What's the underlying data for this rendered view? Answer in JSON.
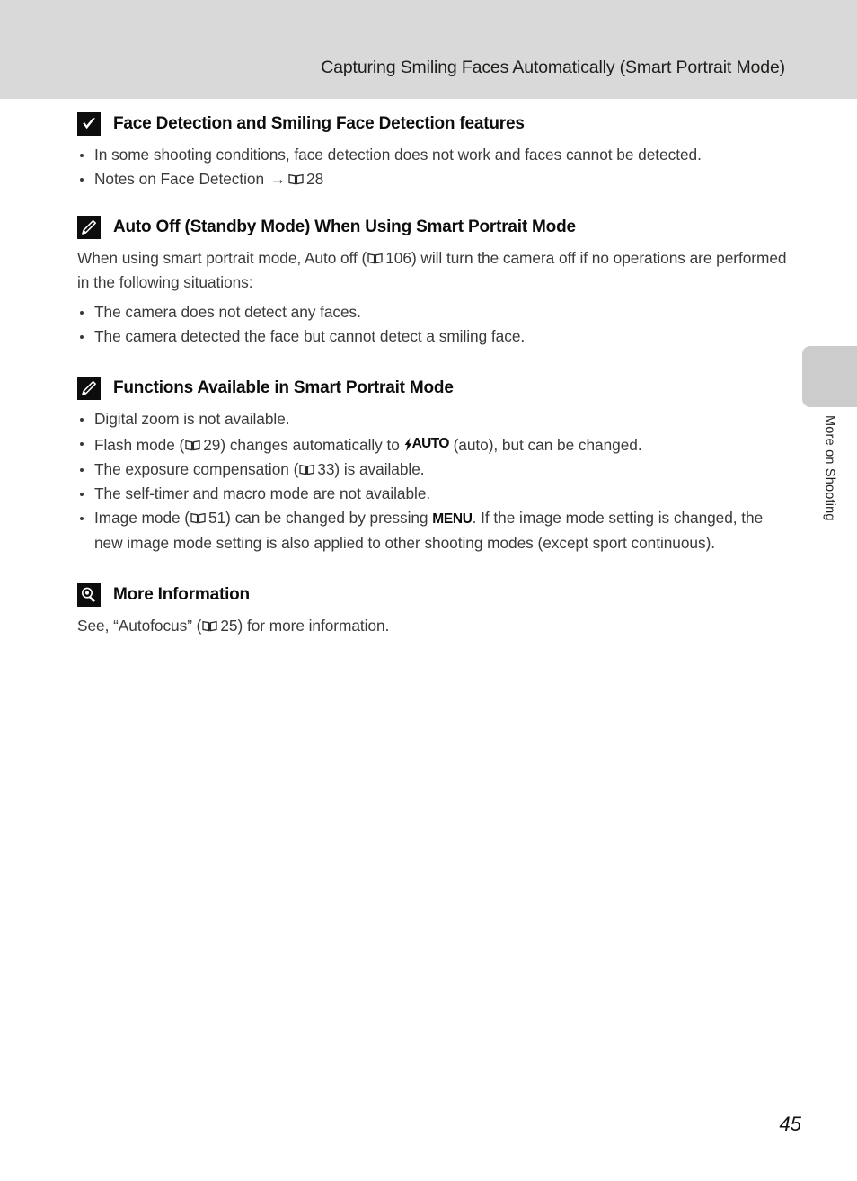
{
  "page": {
    "header_title": "Capturing Smiling Faces Automatically (Smart Portrait Mode)",
    "page_number": "45"
  },
  "side_tab": {
    "label": "More on Shooting"
  },
  "sections": [
    {
      "icon": "caution-check-icon",
      "title": "Face Detection and Smiling Face Detection features",
      "bullets": [
        {
          "parts": [
            {
              "text": "In some shooting conditions, face detection does not work and faces cannot be detected."
            }
          ]
        },
        {
          "parts": [
            {
              "text": "Notes on Face Detection "
            },
            {
              "glyph": "arrow-right",
              "text": "→"
            },
            {
              "glyph": "book-icon"
            },
            {
              "text": " 28"
            }
          ]
        }
      ]
    },
    {
      "icon": "pencil-note-icon",
      "title": "Auto Off (Standby Mode) When Using Smart Portrait Mode",
      "paragraph": {
        "pre": "When using smart portrait mode, Auto off (",
        "ref": "106",
        "post": ") will turn the camera off if no operations are performed in the following situations:"
      },
      "bullets": [
        {
          "parts": [
            {
              "text": "The camera does not detect any faces."
            }
          ]
        },
        {
          "parts": [
            {
              "text": "The camera detected the face but cannot detect a smiling face."
            }
          ]
        }
      ]
    },
    {
      "icon": "pencil-note-icon",
      "title": "Functions Available in Smart Portrait Mode",
      "bullets": [
        {
          "parts": [
            {
              "text": "Digital zoom is not available."
            }
          ]
        },
        {
          "parts": [
            {
              "text": "Flash mode ("
            },
            {
              "glyph": "book-icon"
            },
            {
              "text": " 29) changes automatically to "
            },
            {
              "glyph": "flash-auto-icon",
              "text": "AUTO"
            },
            {
              "text": " (auto), but can be changed."
            }
          ]
        },
        {
          "parts": [
            {
              "text": "The exposure compensation ("
            },
            {
              "glyph": "book-icon"
            },
            {
              "text": " 33) is available."
            }
          ]
        },
        {
          "parts": [
            {
              "text": "The self-timer and macro mode are not available."
            }
          ]
        },
        {
          "parts": [
            {
              "text": "Image mode ("
            },
            {
              "glyph": "book-icon"
            },
            {
              "text": " 51) can be changed by pressing "
            },
            {
              "glyph": "menu-button-glyph",
              "text": "MENU"
            },
            {
              "text": ". If the image mode setting is changed, the new image mode setting is also applied to other shooting modes (except sport continuous)."
            }
          ]
        }
      ]
    },
    {
      "icon": "magnifier-tip-icon",
      "title": "More Information",
      "paragraph": {
        "pre": "See, “Autofocus” (",
        "ref": "25",
        "post": ") for more information."
      }
    }
  ],
  "text": {
    "s1_b1": "In some shooting conditions, face detection does not work and faces cannot be detected.",
    "s1_b2_pre": "Notes on Face Detection ",
    "s1_b2_arrow": "→",
    "s1_b2_ref": "28",
    "s2_p_pre": "When using smart portrait mode, Auto off (",
    "s2_p_ref": "106",
    "s2_p_post": ") will turn the camera off if no operations are performed in the following situations:",
    "s2_b1": "The camera does not detect any faces.",
    "s2_b2": "The camera detected the face but cannot detect a smiling face.",
    "s3_b1": "Digital zoom is not available.",
    "s3_b2_pre": "Flash mode (",
    "s3_b2_ref": "29",
    "s3_b2_mid": ") changes automatically to ",
    "s3_b2_flash": "AUTO",
    "s3_b2_post": " (auto), but can be changed.",
    "s3_b3_pre": "The exposure compensation (",
    "s3_b3_ref": "33",
    "s3_b3_post": ") is available.",
    "s3_b4": "The self-timer and macro mode are not available.",
    "s3_b5_pre": "Image mode (",
    "s3_b5_ref": "51",
    "s3_b5_mid": ") can be changed by pressing ",
    "s3_b5_menu": "MENU",
    "s3_b5_post": ". If the image mode setting is changed, the new image mode setting is also applied to other shooting modes (except sport continuous).",
    "s4_p_pre": "See, “Autofocus” (",
    "s4_p_ref": "25",
    "s4_p_post": ") for more information."
  },
  "colors": {
    "header_band": "#d9d9d9",
    "side_tab": "#cccccc",
    "icon_box": "#0d0d0d",
    "body_text": "#3a3a3a",
    "heading_text": "#0d0d0d"
  }
}
